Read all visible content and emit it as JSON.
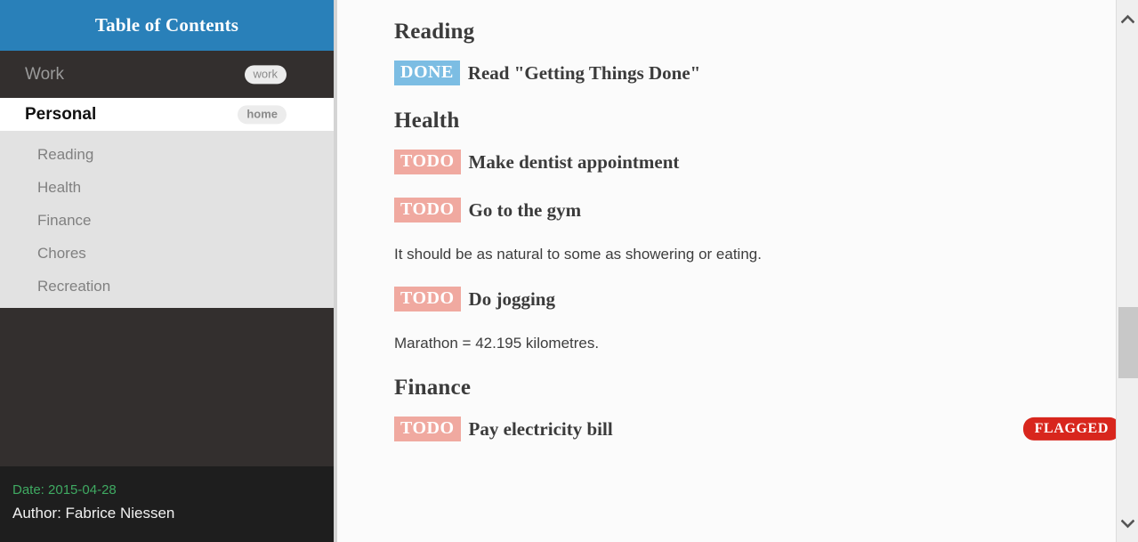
{
  "sidebar": {
    "header_title": "Table of Contents",
    "top_items": [
      {
        "label": "Work",
        "tag": "work",
        "active": false
      },
      {
        "label": "Personal",
        "tag": "home",
        "active": true
      }
    ],
    "sub_items": [
      {
        "label": "Reading"
      },
      {
        "label": "Health"
      },
      {
        "label": "Finance"
      },
      {
        "label": "Chores"
      },
      {
        "label": "Recreation"
      }
    ],
    "footer": {
      "date": "Date: 2015-04-28",
      "author": "Author: Fabrice Niessen"
    }
  },
  "main": {
    "sections": [
      {
        "heading": "Reading",
        "blocks": [
          {
            "type": "todo",
            "keyword": "DONE",
            "title": "Read \"Getting Things Done\"",
            "flag": null
          }
        ]
      },
      {
        "heading": "Health",
        "blocks": [
          {
            "type": "todo",
            "keyword": "TODO",
            "title": "Make dentist appointment",
            "flag": null
          },
          {
            "type": "todo",
            "keyword": "TODO",
            "title": "Go to the gym",
            "flag": null
          },
          {
            "type": "text",
            "text": "It should be as natural to some as showering or eating."
          },
          {
            "type": "todo",
            "keyword": "TODO",
            "title": "Do jogging",
            "flag": null
          },
          {
            "type": "text",
            "text": "Marathon = 42.195 kilometres."
          }
        ]
      },
      {
        "heading": "Finance",
        "blocks": [
          {
            "type": "todo",
            "keyword": "TODO",
            "title": "Pay electricity bill",
            "flag": "FLAGGED"
          }
        ]
      }
    ]
  },
  "scrollbar": {
    "up_icon": "chevron-up-icon",
    "down_icon": "chevron-down-icon"
  },
  "colors": {
    "header_blue": "#2980b9",
    "sidebar_dark": "#332f2e",
    "sidebar_footer": "#1e1e1e",
    "date_green": "#3faa62",
    "todo_salmon": "#f0a9a0",
    "done_blue": "#7cbde3",
    "flagged_red": "#d8261d"
  }
}
